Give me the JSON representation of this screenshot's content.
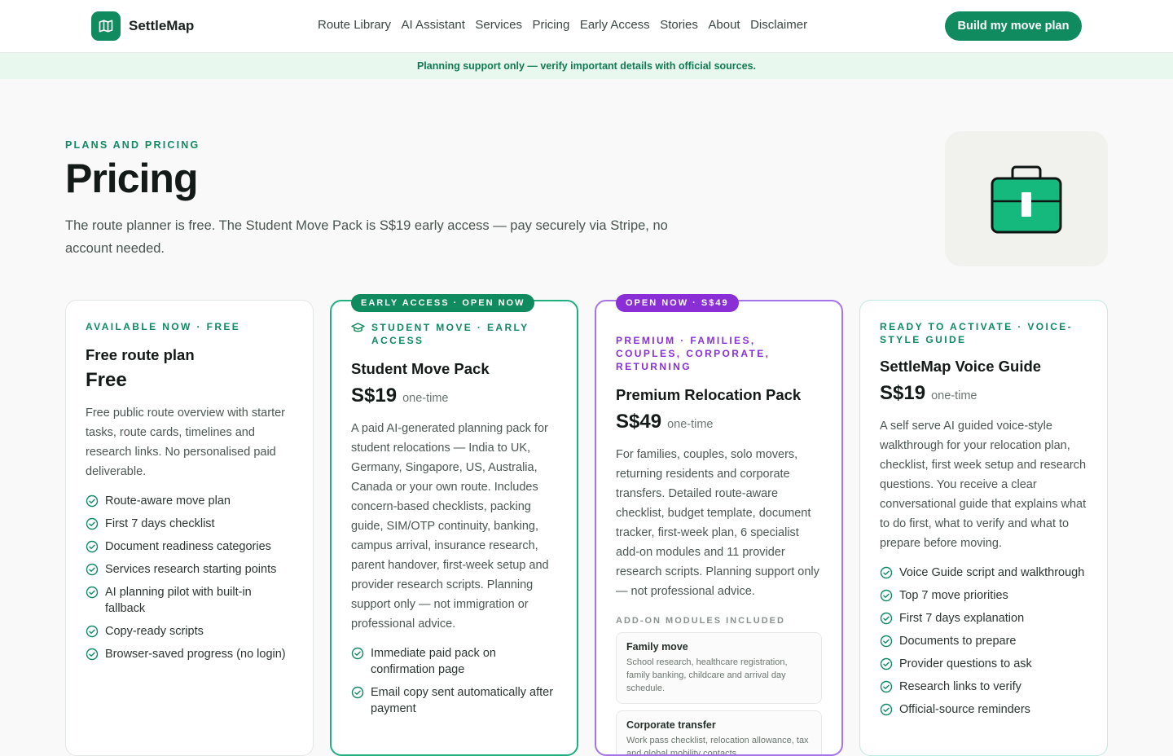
{
  "brand": {
    "name": "SettleMap",
    "accent": "#0f8b5f",
    "logo_icon": "map-icon"
  },
  "nav": [
    "Route Library",
    "AI Assistant",
    "Services",
    "Pricing",
    "Early Access",
    "Stories",
    "About",
    "Disclaimer"
  ],
  "cta_label": "Build my move plan",
  "banner": "Planning support only — verify important details with official sources.",
  "hero": {
    "eyebrow": "PLANS AND PRICING",
    "title": "Pricing",
    "lead": "The route planner is free. The Student Move Pack is S$19 early access — pay securely via Stripe, no account needed.",
    "art_icon": "briefcase-icon"
  },
  "cards": [
    {
      "tag": "AVAILABLE NOW · FREE",
      "title": "Free route plan",
      "price": "Free",
      "price_note": "",
      "desc": "Free public route overview with starter tasks, route cards, timelines and research links. No personalised paid deliverable.",
      "features": [
        "Route-aware move plan",
        "First 7 days checklist",
        "Document readiness categories",
        "Services research starting points",
        "AI planning pilot with built-in fallback",
        "Copy-ready scripts",
        "Browser-saved progress (no login)"
      ]
    },
    {
      "badge": "EARLY ACCESS · OPEN NOW",
      "badge_color": "#0f8b5f",
      "tag": "STUDENT MOVE · EARLY ACCESS",
      "tag_icon": "graduation-cap-icon",
      "title": "Student Move Pack",
      "price": "S$19",
      "price_note": "one-time",
      "desc": "A paid AI-generated planning pack for student relocations — India to UK, Germany, Singapore, US, Australia, Canada or your own route. Includes concern-based checklists, packing guide, SIM/OTP continuity, banking, campus arrival, insurance research, parent handover, first-week setup and provider research scripts. Planning support only — not immigration or professional advice.",
      "features": [
        "Immediate paid pack on confirmation page",
        "Email copy sent automatically after payment"
      ]
    },
    {
      "badge": "OPEN NOW · S$49",
      "badge_color": "#8a2fd6",
      "tag": "PREMIUM · FAMILIES, COUPLES, CORPORATE, RETURNING",
      "title": "Premium Relocation Pack",
      "price": "S$49",
      "price_note": "one-time",
      "desc": "For families, couples, solo movers, returning residents and corporate transfers. Detailed route-aware checklist, budget template, document tracker, first-week plan, 6 specialist add-on modules and 11 provider research scripts. Planning support only — not professional advice.",
      "addons_heading": "ADD-ON MODULES INCLUDED",
      "addons": [
        {
          "title": "Family move",
          "desc": "School research, healthcare registration, family banking, childcare and arrival day schedule."
        },
        {
          "title": "Corporate transfer",
          "desc": "Work pass checklist, relocation allowance, tax and global mobility contacts."
        }
      ]
    },
    {
      "tag": "READY TO ACTIVATE · VOICE-STYLE GUIDE",
      "title": "SettleMap Voice Guide",
      "price": "S$19",
      "price_note": "one-time",
      "desc": "A self serve AI guided voice-style walkthrough for your relocation plan, checklist, first week setup and research questions. You receive a clear conversational guide that explains what to do first, what to verify and what to prepare before moving.",
      "features": [
        "Voice Guide script and walkthrough",
        "Top 7 move priorities",
        "First 7 days explanation",
        "Documents to prepare",
        "Provider questions to ask",
        "Research links to verify",
        "Official-source reminders"
      ]
    }
  ]
}
